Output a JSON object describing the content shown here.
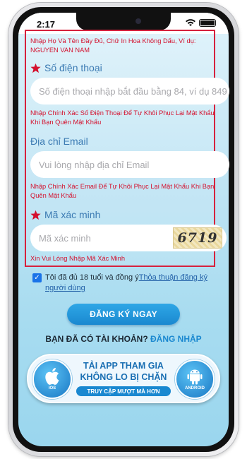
{
  "status_bar": {
    "time": "2:17"
  },
  "form": {
    "name_hint": "Nhập Họ Và Tên Đầy Đủ, Chữ In Hoa Không Dấu, Ví dụ: NGUYEN VAN NAM",
    "phone": {
      "label": "Số điện thoại",
      "placeholder": "Số điện thoại nhập bắt đầu bằng 84, ví dụ 849",
      "hint": "Nhập Chính Xác Số Điện Thoại Để Tự Khôi Phục Lại Mật Khẩu Khi Bạn Quên Mật Khẩu"
    },
    "email": {
      "label": "Địa chỉ Email",
      "placeholder": "Vui lòng nhập địa chỉ Email",
      "hint": "Nhập Chính Xác Email Để Tự Khôi Phục Lại Mật Khẩu Khi Bạn Quên Mật Khẩu"
    },
    "captcha": {
      "label": "Mã xác minh",
      "placeholder": "Mã xác minh",
      "code": "6719",
      "hint": "Xin Vui Lòng Nhập Mã Xác Minh"
    }
  },
  "agreement": {
    "text": "Tôi đã đủ 18 tuổi và đồng ý",
    "link": "Thỏa thuận đăng ký người dùng",
    "checked": true
  },
  "register_button": "ĐĂNG KÝ NGAY",
  "login_prompt": {
    "text": "BẠN ĐÃ CÓ TÀI KHOẢN?",
    "link": "ĐĂNG NHẬP"
  },
  "app_banner": {
    "title_line1": "TẢI APP THAM GIA",
    "title_line2": "KHÔNG LO BỊ CHẶN",
    "subtitle": "TRUY CẬP MƯỢT MÀ HƠN",
    "ios_label": "IOS",
    "android_label": "ANDROID"
  },
  "colors": {
    "accent": "#1a88d0",
    "error": "#d4112e",
    "label": "#3c7bb3"
  }
}
